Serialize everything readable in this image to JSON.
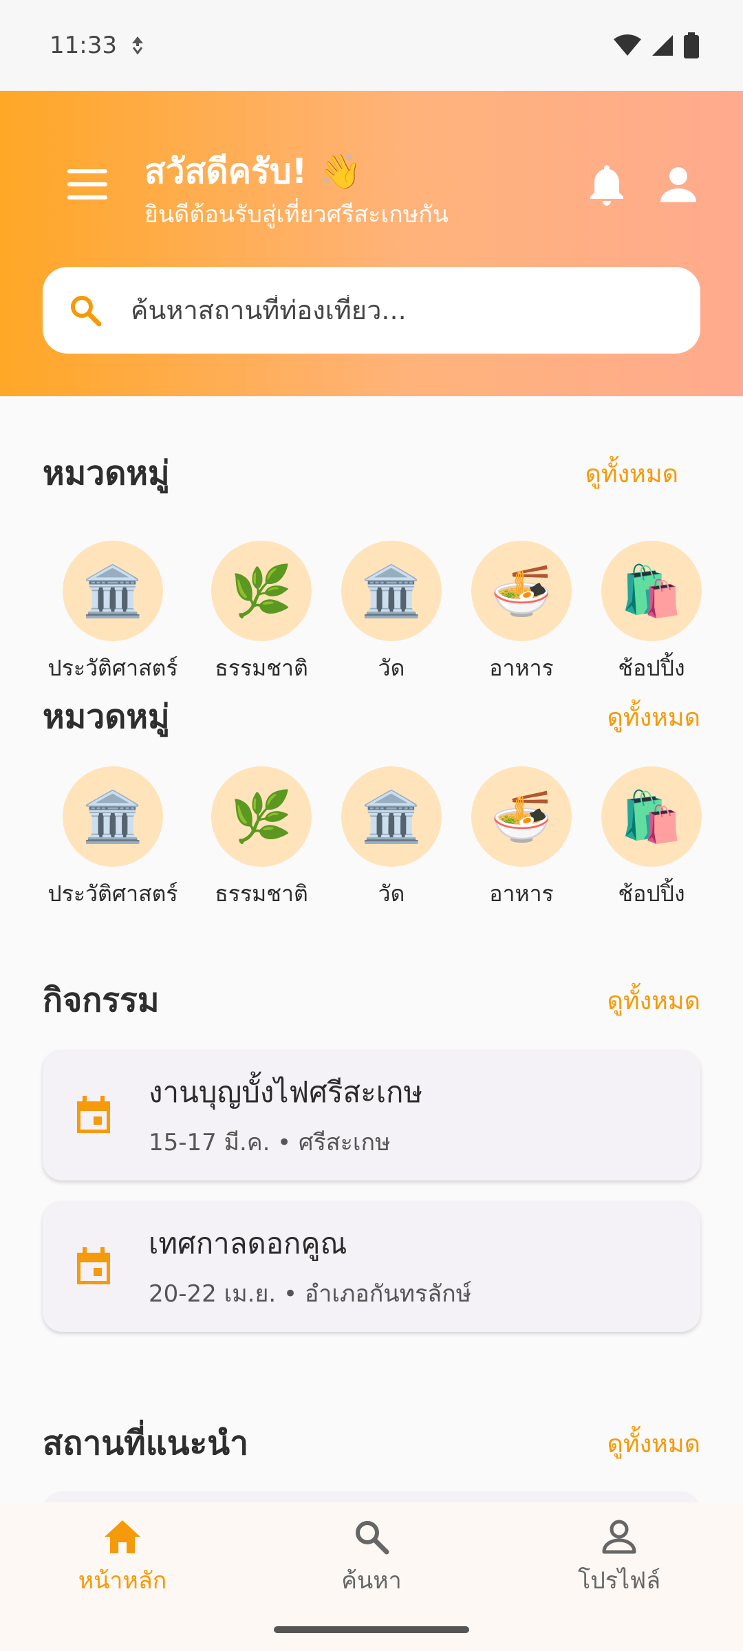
{
  "status_bar": {
    "time": "11:33"
  },
  "header": {
    "title": "สวัสดีครับ! 👋",
    "subtitle": "ยินดีต้อนรับสู่เที่ยวศรีสะเกษกัน"
  },
  "search": {
    "placeholder": "ค้นหาสถานที่ท่องเที่ยว..."
  },
  "categories_1": {
    "title": "หมวดหมู่",
    "see_all": "ดูทั้งหมด",
    "items": [
      {
        "emoji": "🏛️",
        "label": "ประวัติศาสตร์"
      },
      {
        "emoji": "🌿",
        "label": "ธรรมชาติ"
      },
      {
        "emoji": "🏛️",
        "label": "วัด"
      },
      {
        "emoji": "🍜",
        "label": "อาหาร"
      },
      {
        "emoji": "🛍️",
        "label": "ช้อปปิ้ง"
      }
    ]
  },
  "categories_2": {
    "title": "หมวดหมู่",
    "see_all": "ดูทั้งหมด",
    "items": [
      {
        "emoji": "🏛️",
        "label": "ประวัติศาสตร์"
      },
      {
        "emoji": "🌿",
        "label": "ธรรมชาติ"
      },
      {
        "emoji": "🏛️",
        "label": "วัด"
      },
      {
        "emoji": "🍜",
        "label": "อาหาร"
      },
      {
        "emoji": "🛍️",
        "label": "ช้อปปิ้ง"
      }
    ]
  },
  "activities": {
    "title": "กิจกรรม",
    "see_all": "ดูทั้งหมด",
    "items": [
      {
        "title": "งานบุญบั้งไฟศรีสะเกษ",
        "subtitle": "15-17 มี.ค. • ศรีสะเกษ"
      },
      {
        "title": "เทศกาลดอกคูณ",
        "subtitle": "20-22 เม.ย. • อำเภอกันทรลักษ์"
      }
    ]
  },
  "recommended": {
    "title": "สถานที่แนะนำ",
    "see_all": "ดูทั้งหมด"
  },
  "bottom_nav": {
    "items": [
      {
        "label": "หน้าหลัก",
        "icon": "home-icon",
        "active": true
      },
      {
        "label": "ค้นหา",
        "icon": "search-icon",
        "active": false
      },
      {
        "label": "โปรไฟล์",
        "icon": "person-icon",
        "active": false
      }
    ]
  },
  "colors": {
    "accent": "#F59A0A",
    "header_start": "#FFA726",
    "header_end": "#FFAA8E",
    "inactive": "#666666",
    "category_bg": "#FFE3BA"
  }
}
